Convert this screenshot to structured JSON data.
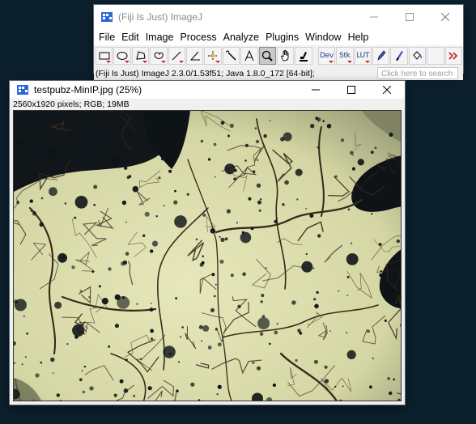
{
  "main_window": {
    "title": "(Fiji Is Just) ImageJ",
    "menus": [
      "File",
      "Edit",
      "Image",
      "Process",
      "Analyze",
      "Plugins",
      "Window",
      "Help"
    ],
    "tools": {
      "dev_label": "Dev",
      "stk_label": "Stk",
      "lut_label": "LUT"
    },
    "status_text": "(Fiji Is Just) ImageJ 2.3.0/1.53f51; Java 1.8.0_172 [64-bit];",
    "search_placeholder": "Click here to search"
  },
  "image_window": {
    "title": "testpubz-MinIP.jpg (25%)",
    "info": "2560x1920 pixels; RGB; 19MB"
  },
  "colors": {
    "desktop": "#0c1f2c",
    "specimen_light": "#e2e4b4",
    "specimen_dark": "#0e1316",
    "vein": "#3a2a1a"
  }
}
